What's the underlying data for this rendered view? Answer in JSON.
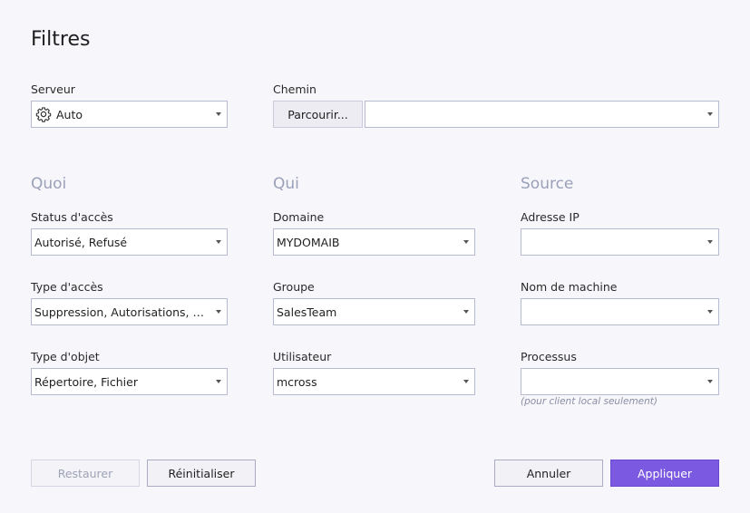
{
  "title": "Filtres",
  "server": {
    "label": "Serveur",
    "value": "Auto",
    "icon": "gear-icon"
  },
  "path": {
    "label": "Chemin",
    "browse_label": "Parcourir...",
    "value": ""
  },
  "sections": {
    "what": "Quoi",
    "who": "Qui",
    "source": "Source"
  },
  "access_status": {
    "label": "Status d'accès",
    "value": "Autorisé, Refusé"
  },
  "access_type": {
    "label": "Type d'accès",
    "value": "Suppression, Autorisations, Ecriture"
  },
  "object_type": {
    "label": "Type d'objet",
    "value": "Répertoire, Fichier"
  },
  "domain": {
    "label": "Domaine",
    "value": "MYDOMAIB"
  },
  "group": {
    "label": "Groupe",
    "value": "SalesTeam"
  },
  "user": {
    "label": "Utilisateur",
    "value": "mcross"
  },
  "ip": {
    "label": "Adresse IP",
    "value": ""
  },
  "machine": {
    "label": "Nom de machine",
    "value": ""
  },
  "process": {
    "label": "Processus",
    "value": "",
    "hint": "(pour client local seulement)"
  },
  "buttons": {
    "restore": "Restaurer",
    "reset": "Réinitialiser",
    "cancel": "Annuler",
    "apply": "Appliquer"
  },
  "colors": {
    "accent": "#7b59e0",
    "border": "#b7bad3",
    "section": "#9aa0b8",
    "background": "#f7f7fb"
  }
}
